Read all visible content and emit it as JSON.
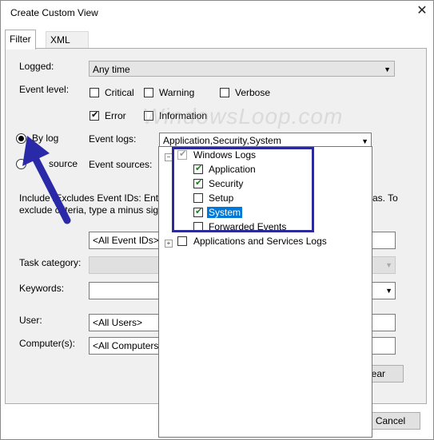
{
  "window": {
    "title": "Create Custom View",
    "close_glyph": "✕"
  },
  "tabs": [
    {
      "label": "Filter"
    },
    {
      "label": "XML"
    }
  ],
  "logged": {
    "label": "Logged:",
    "value": "Any time"
  },
  "event_level": {
    "label": "Event level:",
    "options": [
      {
        "label": "Critical",
        "checked": false
      },
      {
        "label": "Warning",
        "checked": false
      },
      {
        "label": "Verbose",
        "checked": false
      },
      {
        "label": "Error",
        "checked": true
      },
      {
        "label": "Information",
        "checked": false
      }
    ]
  },
  "by_log": {
    "label": "By log",
    "selected": true
  },
  "by_source": {
    "label": "source",
    "selected": false
  },
  "event_logs": {
    "label": "Event logs:",
    "value": "Application,Security,System"
  },
  "event_sources": {
    "label": "Event sources:"
  },
  "description": {
    "line1": "Include /Excludes Event IDs: Ente",
    "line1_end": "as. To",
    "line2": "exclude criteria, type a minus sign"
  },
  "event_ids": {
    "value": "<All Event IDs>"
  },
  "task_category": {
    "label": "Task category:"
  },
  "keywords": {
    "label": "Keywords:"
  },
  "user": {
    "label": "User:",
    "value": "<All Users>"
  },
  "computers": {
    "label": "Computer(s):",
    "value": "<All Computers"
  },
  "buttons": {
    "clear": "ear",
    "cancel": "Cancel"
  },
  "tree": {
    "root": {
      "label": "Windows Logs",
      "expand": "−"
    },
    "children": [
      {
        "label": "Application",
        "checked": true
      },
      {
        "label": "Security",
        "checked": true
      },
      {
        "label": "Setup",
        "checked": false
      },
      {
        "label": "System",
        "checked": true,
        "highlighted": true
      },
      {
        "label": "Forwarded Events",
        "checked": false
      }
    ],
    "second_root": {
      "label": "Applications and Services Logs",
      "expand": "+"
    }
  },
  "watermark": "WindowsLoop.com",
  "colors": {
    "annotation_box": "#2a2a9a",
    "annotation_arrow": "#2a2aa8",
    "selection": "#0078d7"
  },
  "check_glyph": "✔",
  "arrow_glyph": "▼"
}
